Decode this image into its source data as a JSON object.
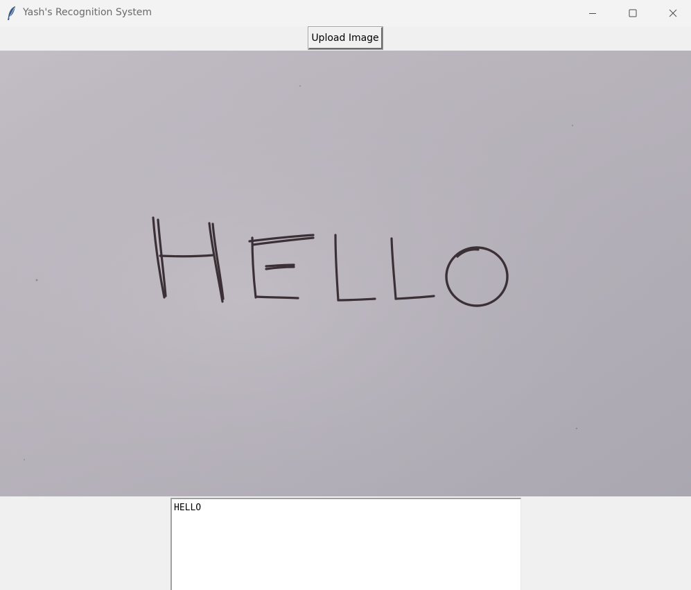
{
  "window": {
    "title": "Yash's Recognition System",
    "app_icon": "feather-icon",
    "controls": [
      "minimize-icon",
      "maximize-icon",
      "close-icon"
    ]
  },
  "toolbar": {
    "upload_label": "Upload Image"
  },
  "image": {
    "content": "handwritten-word-on-paper",
    "handwritten_text": "HELLO"
  },
  "output": {
    "text": "HELLO"
  },
  "colors": {
    "background": "#f0f0f0",
    "paper": "#b7b2b9",
    "ink": "#3b3036"
  }
}
